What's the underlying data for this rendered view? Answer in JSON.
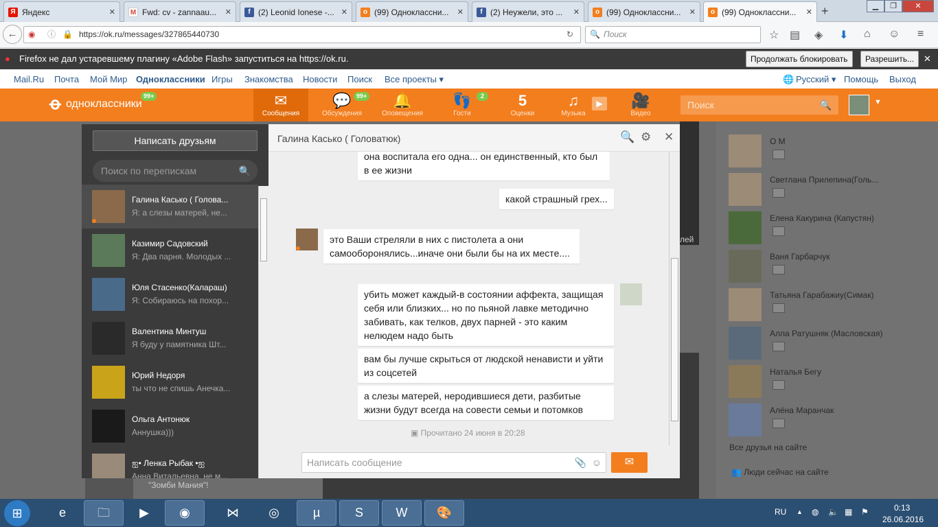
{
  "browser": {
    "tabs": [
      {
        "label": "Яндекс",
        "icon": "yandex-icon",
        "color": "#e61400"
      },
      {
        "label": "Fwd: cv - zannaau...",
        "icon": "gmail-icon",
        "color": "#d44638"
      },
      {
        "label": "(2) Leonid Ionese -...",
        "icon": "facebook-icon",
        "color": "#3b5998"
      },
      {
        "label": "(99) Одноклассни...",
        "icon": "ok-icon",
        "color": "#f37e1e"
      },
      {
        "label": "(2) Неужели, это ...",
        "icon": "facebook-icon",
        "color": "#3b5998"
      },
      {
        "label": "(99) Одноклассни...",
        "icon": "ok-icon",
        "color": "#f37e1e"
      },
      {
        "label": "(99) Одноклассни...",
        "icon": "ok-icon",
        "color": "#f37e1e"
      }
    ],
    "new_tab": "+",
    "url": "https://ok.ru/messages/327865440730",
    "search_placeholder": "Поиск"
  },
  "flash_bar": {
    "message": "Firefox не дал устаревшему плагину «Adobe Flash» запуститься на https://ok.ru.",
    "continue_label": "Продолжать блокировать",
    "allow_label": "Разрешить...",
    "close": "✕"
  },
  "mailru_nav": {
    "links": [
      "Mail.Ru",
      "Почта",
      "Мой Мир",
      "Одноклассники",
      "Игры",
      "Знакомства",
      "Новости",
      "Поиск",
      "Все проекты ▾"
    ],
    "language": "Русский ▾",
    "help": "Помощь",
    "exit": "Выход"
  },
  "ok_header": {
    "logo_text": "одноклассники",
    "logo_badge": "99+",
    "items": [
      {
        "label": "Сообщения",
        "glyph": "✉",
        "icon": "messages-icon"
      },
      {
        "label": "Обсуждения",
        "glyph": "💬",
        "icon": "discussions-icon",
        "badge": "99+"
      },
      {
        "label": "Оповещения",
        "glyph": "🔔",
        "icon": "notifications-icon"
      },
      {
        "label": "Гости",
        "glyph": "👣",
        "icon": "guests-icon",
        "badge": "2"
      },
      {
        "label": "Оценки",
        "glyph": "5",
        "icon": "ratings-icon"
      },
      {
        "label": "Музыка",
        "glyph": "♫",
        "icon": "music-icon"
      },
      {
        "label": "Видео",
        "glyph": "🎥",
        "icon": "video-icon"
      }
    ],
    "search_placeholder": "Поиск"
  },
  "sidebar": {
    "write_button": "Написать друзьям",
    "search_placeholder": "Поиск по перепискам",
    "conversations": [
      {
        "name": "Галина Касько ( Голова...",
        "preview": "Я: а слезы матерей, не...",
        "selected": true
      },
      {
        "name": "Казимир Садовский",
        "preview": "Я: Два парня. Молодых ..."
      },
      {
        "name": "Юля Стасенко(Калараш)",
        "preview": "Я: Собираюсь на похор..."
      },
      {
        "name": "Валентина Минтуш",
        "preview": "Я буду у памятника Шт..."
      },
      {
        "name": "Юрий Недоря",
        "preview": "ты что не спишь Анечка..."
      },
      {
        "name": "Ольга Антонюк",
        "preview": "Аннушка)))"
      },
      {
        "name": "ஐ• Ленка Рыбак •ஐ",
        "preview": "Анна Витальевна, не м..."
      }
    ]
  },
  "chat": {
    "title": "Галина Касько ( Головатюк)",
    "messages": [
      {
        "side": "out",
        "text": "она воспитала его одна... он единственный, кто был в ее жизни"
      },
      {
        "side": "out",
        "text": "какой страшный грех..."
      },
      {
        "side": "in",
        "text": "это Ваши стреляли в них с пистолета а они самооборонялись...иначе они были бы на их месте...."
      },
      {
        "side": "out",
        "text": "убить может каждый-в состоянии аффекта, защищая себя или близких... но по пьяной лавке методично забивать, как телков, двух парней - это каким нелюдем надо быть"
      },
      {
        "side": "out",
        "text": "вам бы лучше скрыться от людской ненависти и уйти из соцсетей"
      },
      {
        "side": "out",
        "text": "а слезы матерей, неродившиеся дети, разбитые жизни будут всегда на совести семьи и потомков"
      }
    ],
    "read_status": "Прочитано 24 июня в 20:28",
    "input_placeholder": "Написать сообщение"
  },
  "right_panel": {
    "friends": [
      "О М",
      "Светлана Прилепина(Голь...",
      "Елена Какурина (Капустян)",
      "Ваня Гарбарчук",
      "Татьяна Гарабажиу(Симак)",
      "Алла Ратушняк (Масловская)",
      "Наталья Бегу",
      "Алёна Маранчак"
    ],
    "all_friends": "Все друзья на сайте",
    "people_online": "Люди сейчас на сайте"
  },
  "background_text": {
    "zombie": "\"Зомби Мания\"!",
    "partial": "лей"
  },
  "taskbar": {
    "lang": "RU",
    "time": "0:13",
    "date": "26.06.2016"
  },
  "colors": {
    "ok_orange": "#f37e1e",
    "badge_green": "#7bc94b",
    "sidebar_dark": "#3b3b3b"
  }
}
